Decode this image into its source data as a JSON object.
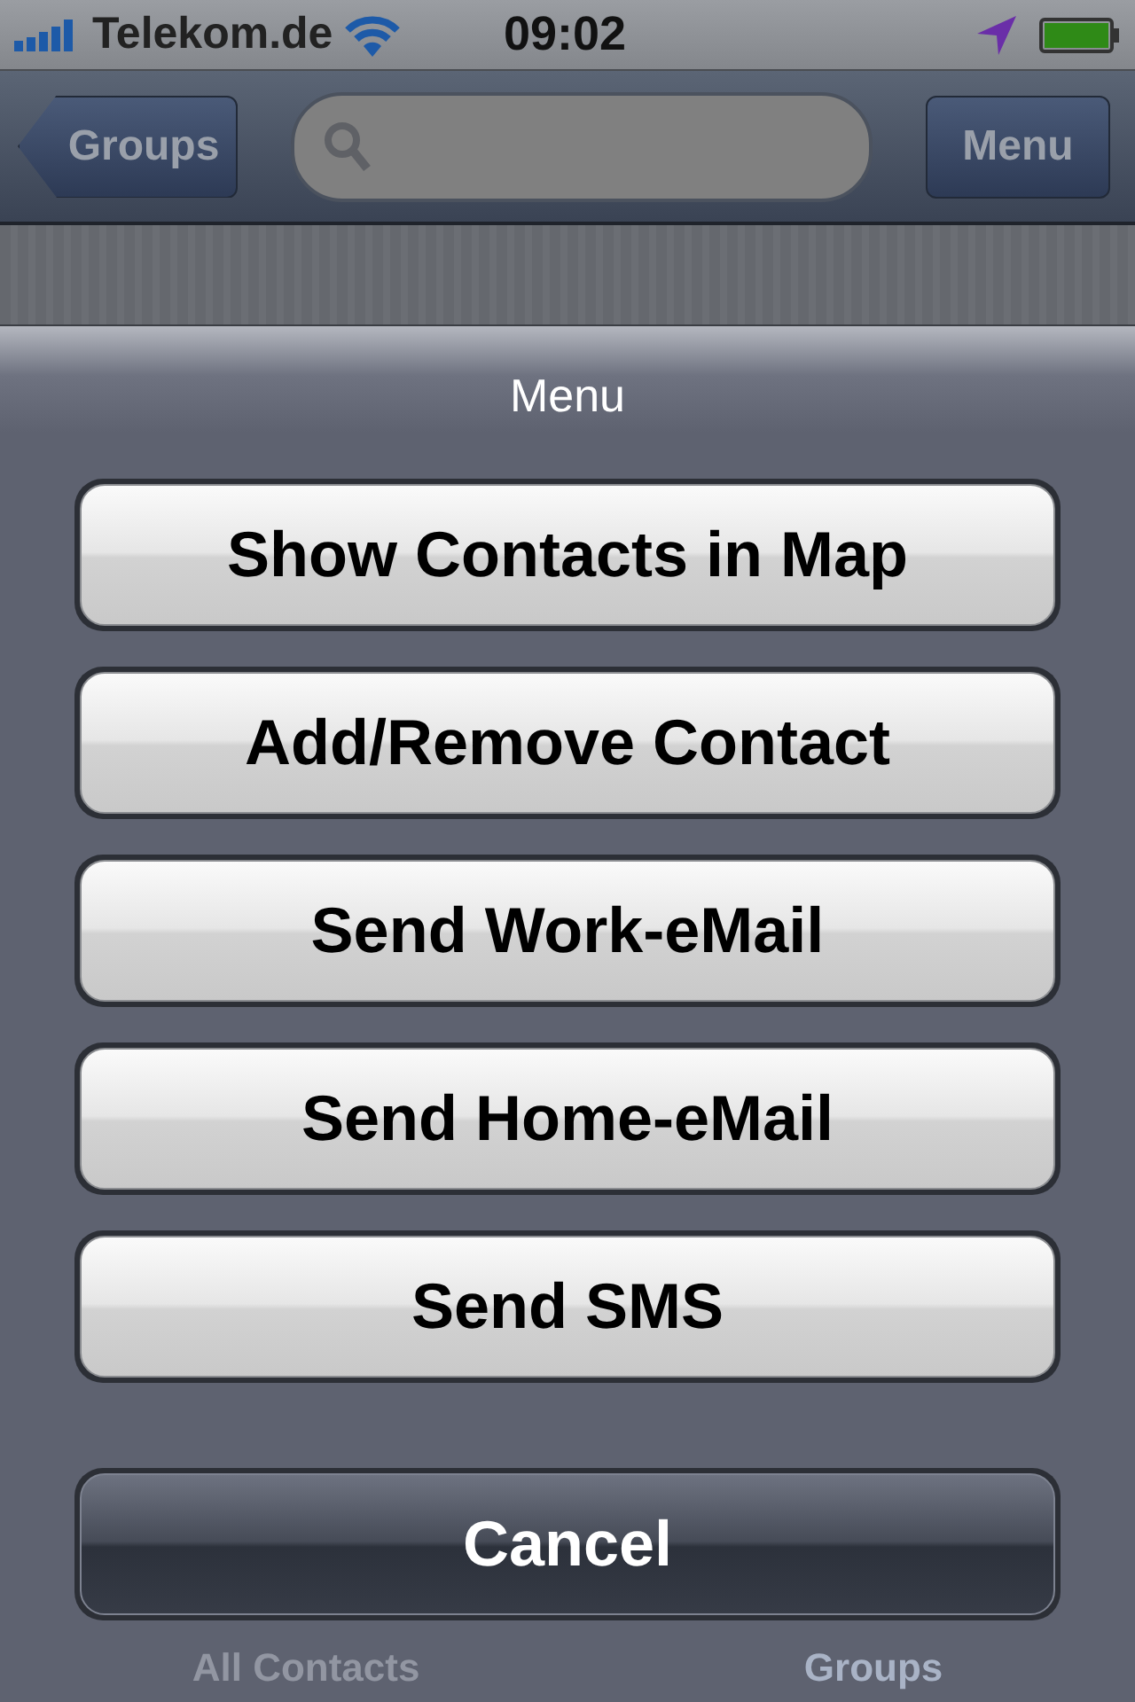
{
  "status_bar": {
    "carrier": "Telekom.de",
    "time": "09:02"
  },
  "nav_bar": {
    "back_button": "Groups",
    "menu_button": "Menu"
  },
  "action_sheet": {
    "title": "Menu",
    "actions": [
      {
        "label": "Show Contacts in Map",
        "kind": "default"
      },
      {
        "label": "Add/Remove Contact",
        "kind": "default"
      },
      {
        "label": "Send Work-eMail",
        "kind": "default"
      },
      {
        "label": "Send Home-eMail",
        "kind": "default"
      },
      {
        "label": "Send SMS",
        "kind": "default"
      },
      {
        "label": "Cancel",
        "kind": "cancel"
      }
    ]
  },
  "tab_bar": {
    "tabs": [
      {
        "label": "All Contacts",
        "selected": false
      },
      {
        "label": "Groups",
        "selected": true
      }
    ]
  }
}
